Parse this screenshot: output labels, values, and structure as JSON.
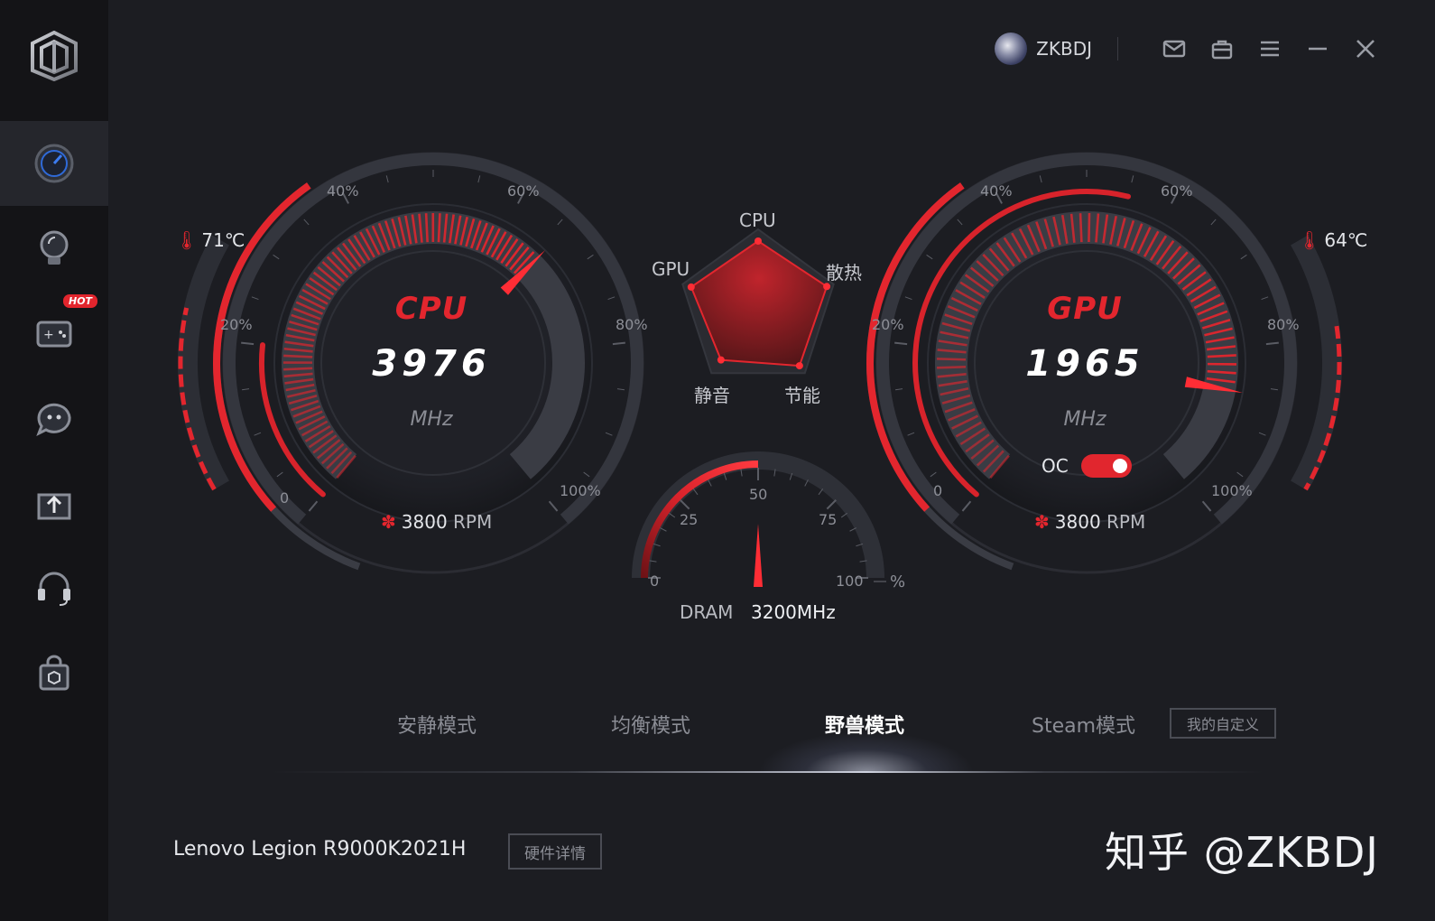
{
  "titlebar": {
    "username": "ZKBDJ",
    "icons": [
      "mail-icon",
      "store-icon",
      "menu-icon",
      "minimize-icon",
      "close-icon"
    ]
  },
  "sidebar": {
    "items": [
      {
        "icon": "speedometer-icon",
        "active": true
      },
      {
        "icon": "lightbulb-icon",
        "active": false
      },
      {
        "icon": "gamepad-icon",
        "active": false,
        "badge": "HOT"
      },
      {
        "icon": "chat-bubble-icon",
        "active": false
      },
      {
        "icon": "upload-tray-icon",
        "active": false
      },
      {
        "icon": "headset-icon",
        "active": false
      },
      {
        "icon": "shop-bag-icon",
        "active": false
      }
    ]
  },
  "cpu": {
    "title": "CPU",
    "value": "3976",
    "unit": "MHz",
    "temperature": "71℃",
    "fan_value": "3800",
    "fan_unit": "RPM",
    "scale_labels": [
      "0",
      "20%",
      "40%",
      "60%",
      "80%",
      "100%"
    ],
    "usage_fraction": 0.66,
    "load_fraction": 0.2,
    "temp_fraction": 0.71,
    "fan_fraction": 0.78
  },
  "gpu": {
    "title": "GPU",
    "value": "1965",
    "unit": "MHz",
    "temperature": "64℃",
    "fan_value": "3800",
    "fan_unit": "RPM",
    "oc_label": "OC",
    "oc_enabled": true,
    "scale_labels": [
      "0",
      "20%",
      "40%",
      "60%",
      "80%",
      "100%"
    ],
    "usage_fraction": 0.86,
    "load_fraction": 0.55,
    "temp_fraction": 0.64,
    "fan_fraction": 0.78
  },
  "radar": {
    "labels": {
      "top": "CPU",
      "right": "散热",
      "bottom_right": "节能",
      "bottom_left": "静音",
      "left": "GPU"
    }
  },
  "dram": {
    "label": "DRAM",
    "value": "3200MHz",
    "scale_labels": [
      "0",
      "25",
      "50",
      "75",
      "100"
    ],
    "unit": "%",
    "fraction": 0.5
  },
  "modes": {
    "items": [
      "安静模式",
      "均衡模式",
      "野兽模式",
      "Steam模式"
    ],
    "active_index": 2,
    "custom_label": "我的自定义"
  },
  "device": {
    "name": "Lenovo Legion R9000K2021H",
    "details_label": "硬件详情"
  },
  "watermark": "知乎 @ZKBDJ",
  "colors": {
    "accent": "#e3262e",
    "background": "#1c1d22",
    "sidebar": "#141417"
  }
}
